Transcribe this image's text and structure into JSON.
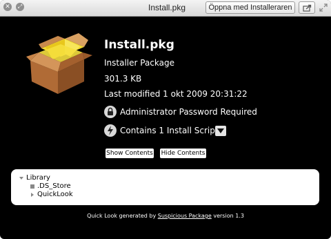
{
  "window": {
    "title": "Install.pkg",
    "open_button_label": "Öppna med Installeraren"
  },
  "package": {
    "name": "Install.pkg",
    "kind": "Installer Package",
    "size": "301.3 KB",
    "last_modified": "Last modified 1 okt 2009 20:31:22",
    "admin_text": "Administrator Password Required",
    "script_text": "Contains 1 Install Script"
  },
  "buttons": {
    "show_contents": "Show Contents",
    "hide_contents": "Hide Contents"
  },
  "tree": [
    {
      "label": "Library",
      "state": "expanded"
    },
    {
      "label": ".DS_Store",
      "state": "file"
    },
    {
      "label": "QuickLook",
      "state": "collapsed"
    }
  ],
  "footer": {
    "prefix": "Quick Look generated by ",
    "link": "Suspicious Package",
    "suffix": " version 1.3"
  },
  "icons": {
    "close": "close-icon",
    "fullscreen": "fullscreen-icon",
    "share": "share-icon",
    "expand": "expand-icon",
    "package": "package-box-icon",
    "lock": "lock-icon",
    "script": "script-bolt-icon",
    "disclosure": "disclosure-triangle-icon"
  }
}
